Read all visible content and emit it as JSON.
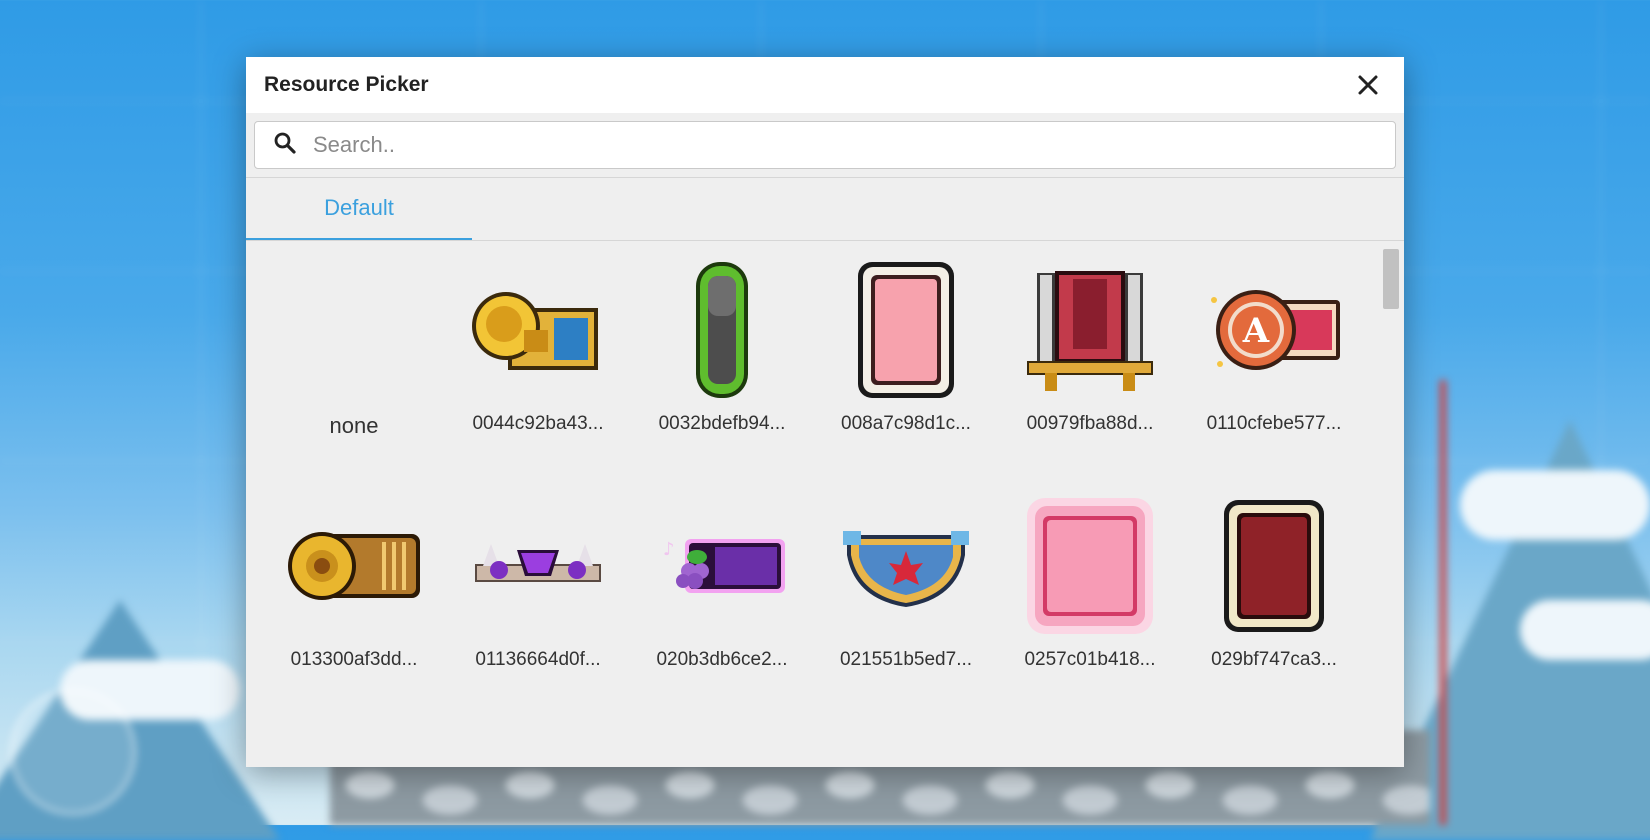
{
  "dialog": {
    "title": "Resource Picker",
    "close_icon": "close-icon",
    "search": {
      "placeholder": "Search..",
      "value": "",
      "icon": "search-icon"
    },
    "tabs": [
      {
        "label": "Default",
        "active": true
      }
    ],
    "accent_color": "#3ba0de"
  },
  "resources": [
    {
      "label": "none",
      "icon": "none"
    },
    {
      "label": "0044c92ba43...",
      "icon": "gramophone-frame-icon"
    },
    {
      "label": "0032bdefb94...",
      "icon": "green-bar-frame-icon"
    },
    {
      "label": "008a7c98d1c...",
      "icon": "pink-card-frame-icon"
    },
    {
      "label": "00979fba88d...",
      "icon": "sword-banner-frame-icon"
    },
    {
      "label": "0110cfebe577...",
      "icon": "letter-a-badge-frame-icon"
    },
    {
      "label": "013300af3dd...",
      "icon": "gold-jewel-bar-icon"
    },
    {
      "label": "01136664d0f...",
      "icon": "purple-crystal-crown-icon"
    },
    {
      "label": "020b3db6ce2...",
      "icon": "grape-purple-tag-icon"
    },
    {
      "label": "021551b5ed7...",
      "icon": "maple-leaf-shield-icon"
    },
    {
      "label": "0257c01b418...",
      "icon": "pink-glow-square-icon"
    },
    {
      "label": "029bf747ca3...",
      "icon": "dark-red-card-frame-icon"
    }
  ]
}
